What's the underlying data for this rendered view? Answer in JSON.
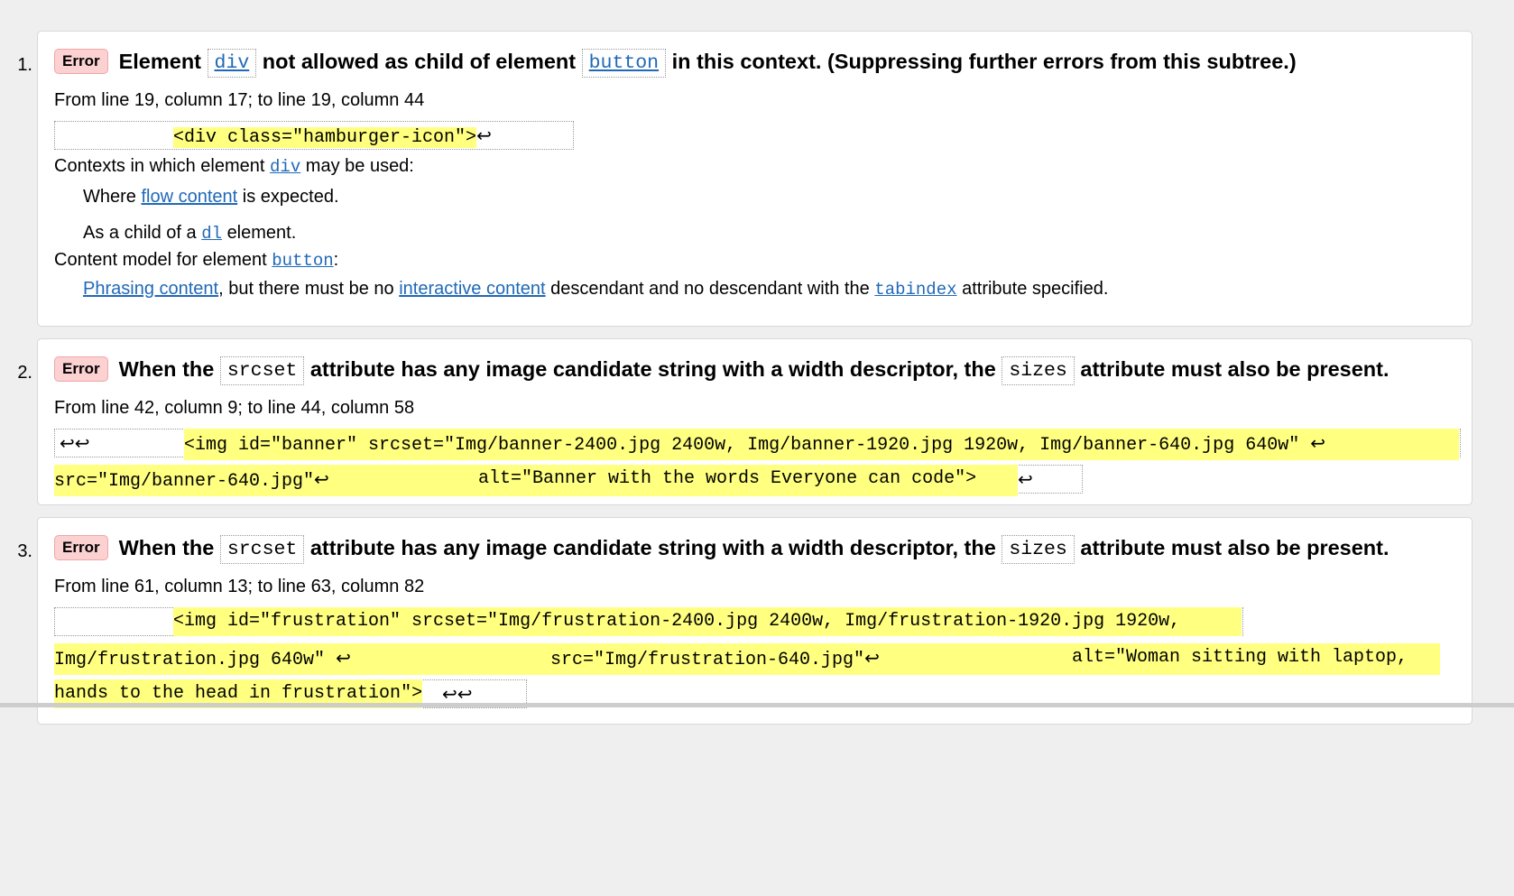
{
  "results": [
    {
      "number": "1.",
      "badge": "Error",
      "message_parts": [
        "Element",
        "div",
        "not allowed as child of element",
        "button",
        "in this context. (Suppressing further errors from this subtree.)"
      ],
      "location": "From line 19, column 17; to line 19, column 44",
      "extract": "<div class=\"hamburger-icon\">",
      "contexts_label_a": "Contexts in which element",
      "contexts_elem": "div",
      "contexts_label_b": "may be used:",
      "where_a": "Where",
      "where_link": "flow content",
      "where_b": "is expected.",
      "aschild_a": "As a child of a",
      "aschild_elem": "dl",
      "aschild_b": "element.",
      "model_label_a": "Content model for element",
      "model_elem": "button",
      "model_colon": ":",
      "model_link1": "Phrasing content",
      "model_text1": ", but there must be no",
      "model_link2": "interactive content",
      "model_text2": "descendant and no descendant with the",
      "model_attr": "tabindex",
      "model_text3": "attribute specified."
    },
    {
      "number": "2.",
      "badge": "Error",
      "message_parts": [
        "When the",
        "srcset",
        "attribute has any image candidate string with a width descriptor, the",
        "sizes",
        "attribute must also be present."
      ],
      "location": "From line 42, column 9; to line 44, column 58",
      "extract_line1": "<img id=\"banner\" srcset=\"Img/banner-2400.jpg 2400w, Img/banner-1920.jpg 1920w, Img/banner-640.jpg 640w\" ",
      "extract_line2a": "src=\"Img/banner-640.jpg\"",
      "extract_line2b": "alt=\"Banner with the words Everyone can code\">"
    },
    {
      "number": "3.",
      "badge": "Error",
      "message_parts": [
        "When the",
        "srcset",
        "attribute has any image candidate string with a width descriptor, the",
        "sizes",
        "attribute must also be present."
      ],
      "location": "From line 61, column 13; to line 63, column 82",
      "extract_line1": "<img id=\"frustration\" srcset=\"Img/frustration-2400.jpg 2400w, Img/frustration-1920.jpg 1920w,",
      "extract_line2a": "Img/frustration.jpg 640w\" ",
      "extract_line2b": "src=\"Img/frustration-640.jpg\"",
      "extract_line2c": "alt=\"Woman sitting with laptop,",
      "extract_line3": "hands to the head in frustration\">"
    }
  ],
  "icons": {
    "return": "↩"
  }
}
